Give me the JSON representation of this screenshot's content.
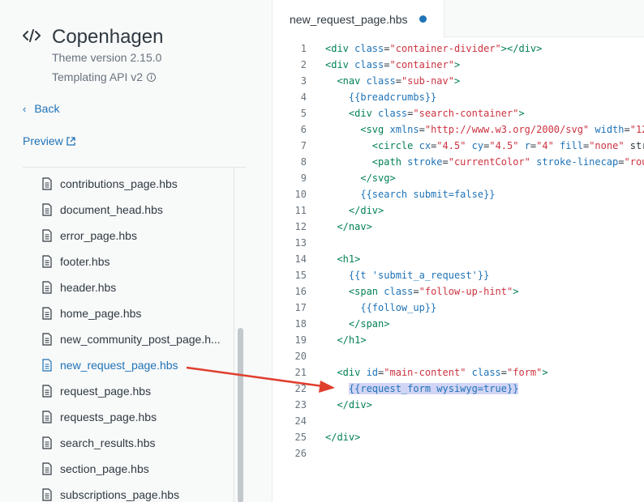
{
  "theme": {
    "name": "Copenhagen",
    "version": "Theme version 2.15.0",
    "api": "Templating API v2"
  },
  "nav": {
    "back_label": "Back",
    "preview_label": "Preview"
  },
  "files": [
    {
      "name": "contributions_page.hbs",
      "active": false
    },
    {
      "name": "document_head.hbs",
      "active": false
    },
    {
      "name": "error_page.hbs",
      "active": false
    },
    {
      "name": "footer.hbs",
      "active": false
    },
    {
      "name": "header.hbs",
      "active": false
    },
    {
      "name": "home_page.hbs",
      "active": false
    },
    {
      "name": "new_community_post_page.h...",
      "active": false
    },
    {
      "name": "new_request_page.hbs",
      "active": true
    },
    {
      "name": "request_page.hbs",
      "active": false
    },
    {
      "name": "requests_page.hbs",
      "active": false
    },
    {
      "name": "search_results.hbs",
      "active": false
    },
    {
      "name": "section_page.hbs",
      "active": false
    },
    {
      "name": "subscriptions_page.hbs",
      "active": false
    }
  ],
  "editor": {
    "tab_label": "new_request_page.hbs",
    "lines": [
      {
        "n": "1",
        "code": "<div class=\"container-divider\"></div>"
      },
      {
        "n": "2",
        "code": "<div class=\"container\">"
      },
      {
        "n": "3",
        "code": "  <nav class=\"sub-nav\">"
      },
      {
        "n": "4",
        "code": "    {{breadcrumbs}}"
      },
      {
        "n": "5",
        "code": "    <div class=\"search-container\">"
      },
      {
        "n": "6",
        "code": "      <svg xmlns=\"http://www.w3.org/2000/svg\" width=\"12"
      },
      {
        "n": "7",
        "code": "        <circle cx=\"4.5\" cy=\"4.5\" r=\"4\" fill=\"none\" str"
      },
      {
        "n": "8",
        "code": "        <path stroke=\"currentColor\" stroke-linecap=\"rou"
      },
      {
        "n": "9",
        "code": "      </svg>"
      },
      {
        "n": "10",
        "code": "      {{search submit=false}}"
      },
      {
        "n": "11",
        "code": "    </div>"
      },
      {
        "n": "12",
        "code": "  </nav>"
      },
      {
        "n": "13",
        "code": ""
      },
      {
        "n": "14",
        "code": "  <h1>"
      },
      {
        "n": "15",
        "code": "    {{t 'submit_a_request'}}"
      },
      {
        "n": "16",
        "code": "    <span class=\"follow-up-hint\">"
      },
      {
        "n": "17",
        "code": "      {{follow_up}}"
      },
      {
        "n": "18",
        "code": "    </span>"
      },
      {
        "n": "19",
        "code": "  </h1>"
      },
      {
        "n": "20",
        "code": ""
      },
      {
        "n": "21",
        "code": "  <div id=\"main-content\" class=\"form\">"
      },
      {
        "n": "22",
        "code": "    {{request_form wysiwyg=true}}",
        "highlight": true
      },
      {
        "n": "23",
        "code": "  </div>"
      },
      {
        "n": "24",
        "code": ""
      },
      {
        "n": "25",
        "code": "</div>"
      },
      {
        "n": "26",
        "code": ""
      }
    ]
  },
  "colors": {
    "accent": "#1f73b7",
    "tag": "#038153",
    "string": "#cc3340",
    "highlight": "#d1d4f5",
    "arrow": "#e03e2d"
  }
}
